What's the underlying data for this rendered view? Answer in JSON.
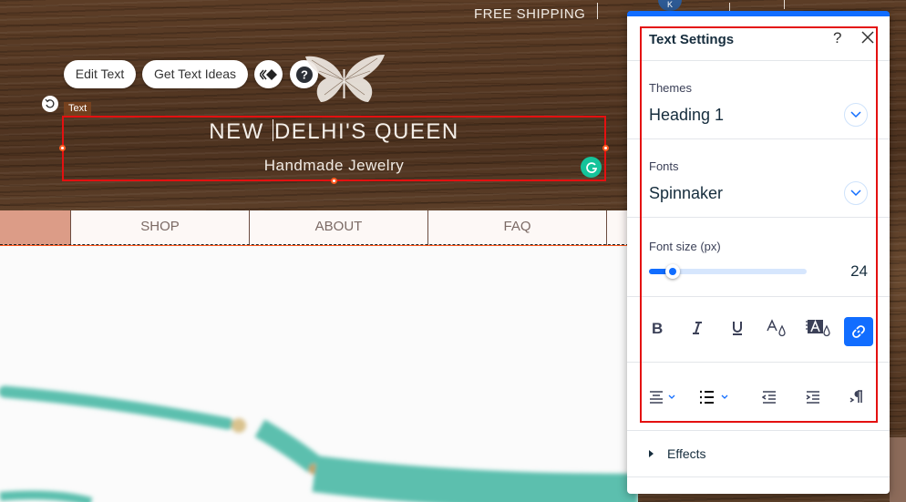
{
  "site": {
    "free_shipping": "FREE SHIPPING",
    "heading_before_caret": "NEW ",
    "heading_after_caret": "DELHI'S QUEEN",
    "subheading": "Handmade Jewelry",
    "element_tag": "Text"
  },
  "toolbar": {
    "edit_text": "Edit Text",
    "get_text_ideas": "Get Text Ideas",
    "animation_icon": "animation-icon",
    "help_icon": "help-icon"
  },
  "nav": {
    "items": [
      {
        "label": "SHOP"
      },
      {
        "label": "ABOUT"
      },
      {
        "label": "FAQ"
      }
    ]
  },
  "panel": {
    "title": "Text Settings",
    "help": "?",
    "themes_label": "Themes",
    "themes_value": "Heading 1",
    "fonts_label": "Fonts",
    "fonts_value": "Spinnaker",
    "font_size_label": "Font size (px)",
    "font_size_value": "24",
    "font_size_slider_fraction": 0.15,
    "format_buttons": [
      "bold",
      "italic",
      "underline",
      "text-color",
      "highlight-color",
      "link"
    ],
    "active_format": "link",
    "layout_buttons": [
      "align-center",
      "bullet-list",
      "decrease-indent",
      "increase-indent",
      "text-direction"
    ],
    "effects_label": "Effects"
  },
  "colors": {
    "accent": "#116dff",
    "selection": "#e41010",
    "handle": "#ff5a1f",
    "grammarly": "#15c39a",
    "nav_highlight": "#dc9c87"
  }
}
